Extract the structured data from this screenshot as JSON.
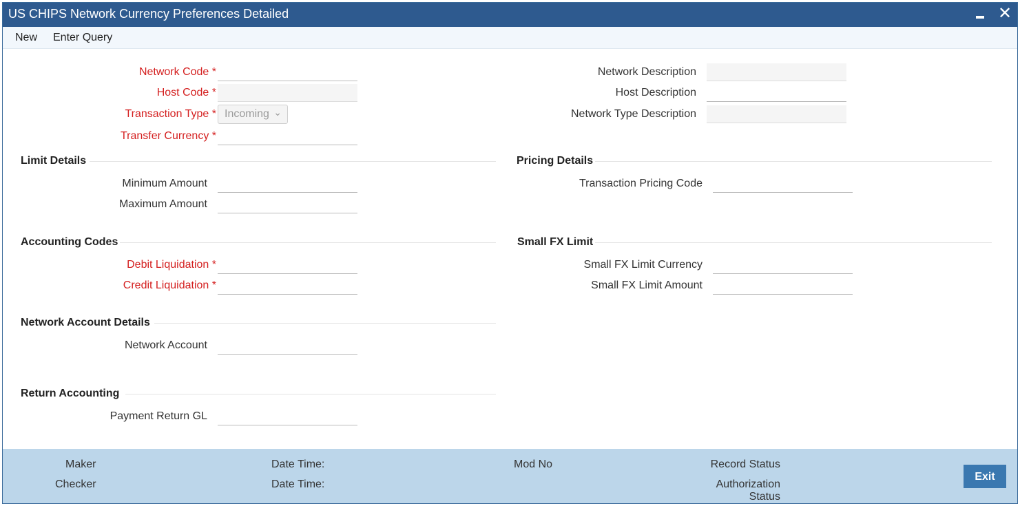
{
  "window": {
    "title": "US CHIPS Network Currency Preferences Detailed",
    "minimize_icon": "minimize-icon",
    "close_icon": "close-icon",
    "close_glyph": "✕"
  },
  "menu": {
    "new_label": "New",
    "enter_query_label": "Enter Query"
  },
  "header": {
    "network_code_label": "Network Code",
    "host_code_label": "Host Code",
    "transaction_type_label": "Transaction Type",
    "transaction_type_value": "Incoming",
    "transfer_currency_label": "Transfer Currency",
    "network_description_label": "Network Description",
    "host_description_label": "Host Description",
    "network_type_description_label": "Network Type Description",
    "required_marker": "*"
  },
  "limit_details": {
    "title": "Limit Details",
    "minimum_amount_label": "Minimum Amount",
    "maximum_amount_label": "Maximum Amount"
  },
  "pricing_details": {
    "title": "Pricing Details",
    "transaction_pricing_code_label": "Transaction Pricing Code"
  },
  "accounting_codes": {
    "title": "Accounting Codes",
    "debit_liquidation_label": "Debit Liquidation",
    "credit_liquidation_label": "Credit Liquidation"
  },
  "small_fx_limit": {
    "title": "Small FX Limit",
    "currency_label": "Small FX Limit Currency",
    "amount_label": "Small FX Limit Amount"
  },
  "network_account_details": {
    "title": "Network Account Details",
    "network_account_label": "Network Account"
  },
  "return_accounting": {
    "title": "Return Accounting",
    "payment_return_gl_label": "Payment Return GL"
  },
  "footer": {
    "maker_label": "Maker",
    "checker_label": "Checker",
    "date_time_label_1": "Date Time:",
    "date_time_label_2": "Date Time:",
    "mod_no_label": "Mod No",
    "record_status_label": "Record Status",
    "authorization_label": "Authorization",
    "status_label": "Status",
    "exit_label": "Exit"
  },
  "colors": {
    "title_bar": "#2e5a8f",
    "required": "#d42020",
    "footer": "#bcd6ea",
    "exit_button": "#3a78b0"
  }
}
